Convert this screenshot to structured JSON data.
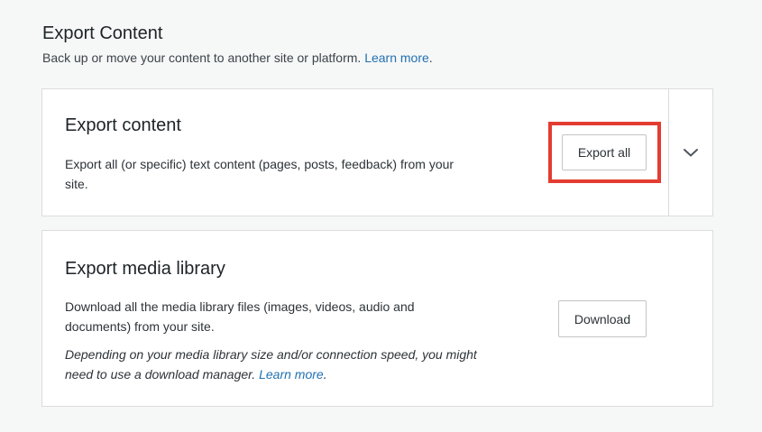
{
  "header": {
    "title": "Export Content",
    "description": "Back up or move your content to another site or platform.",
    "learn_more": "Learn more",
    "trailing": "."
  },
  "export_card": {
    "title": "Export content",
    "description": "Export all (or specific) text content (pages, posts, feedback) from your site.",
    "button_label": "Export all",
    "expand_icon": "chevron-down-icon",
    "highlight_color": "#e43c31"
  },
  "media_card": {
    "title": "Export media library",
    "description": "Download all the media library files (images, videos, audio and documents) from your site.",
    "note": "Depending on your media library size and/or connection speed, you might need to use a download manager.",
    "note_learn_more": "Learn more",
    "note_trailing": ".",
    "button_label": "Download"
  },
  "colors": {
    "link": "#2271b1",
    "background": "#f6f7f7",
    "card": "#ffffff",
    "border": "#dcdcde"
  }
}
